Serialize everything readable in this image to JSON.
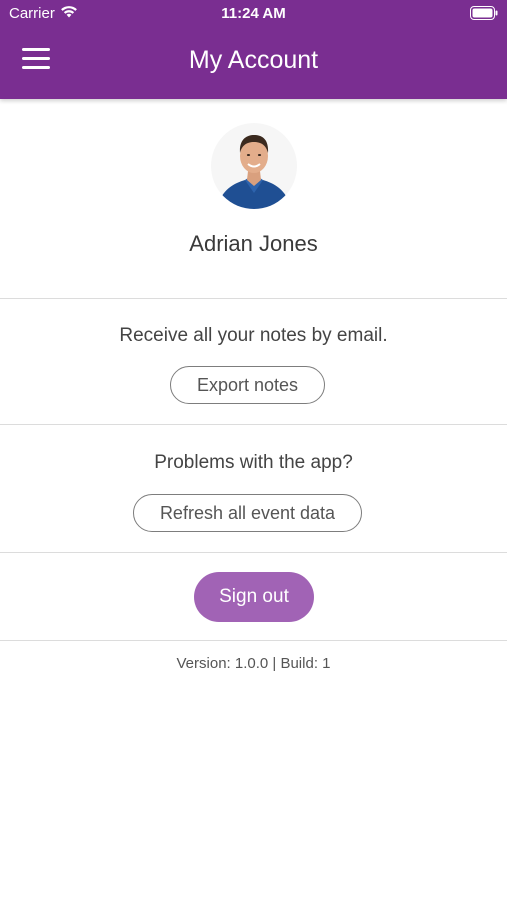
{
  "status_bar": {
    "carrier": "Carrier",
    "time": "11:24 AM",
    "icons": [
      "wifi-icon",
      "battery-icon"
    ]
  },
  "nav": {
    "title": "My Account",
    "menu_icon": "hamburger-menu-icon"
  },
  "profile": {
    "name": "Adrian Jones"
  },
  "export_section": {
    "text": "Receive all your notes by email.",
    "button_label": "Export notes"
  },
  "refresh_section": {
    "text": "Problems with the app?",
    "button_label": "Refresh all event data"
  },
  "signout": {
    "button_label": "Sign out"
  },
  "footer": {
    "version_text": "Version: 1.0.0 | Build: 1"
  },
  "colors": {
    "brand_purple": "#7a2e91",
    "signout_purple": "#a163b5",
    "divider": "#dcdcdc"
  }
}
